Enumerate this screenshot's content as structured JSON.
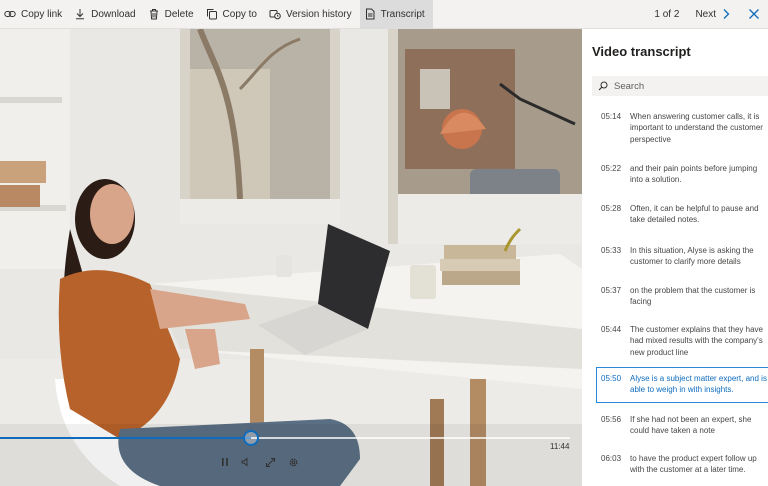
{
  "toolbar": {
    "buttons": [
      {
        "label": "Copy link",
        "icon": "link-icon"
      },
      {
        "label": "Download",
        "icon": "download-icon"
      },
      {
        "label": "Delete",
        "icon": "trash-icon"
      },
      {
        "label": "Copy to",
        "icon": "copy-icon"
      },
      {
        "label": "Version history",
        "icon": "history-icon"
      },
      {
        "label": "Transcript",
        "icon": "transcript-icon",
        "active": true
      }
    ],
    "pager": "1 of 2",
    "next_label": "Next"
  },
  "player": {
    "progress_fraction": 0.44,
    "duration": "11:44"
  },
  "transcript": {
    "title": "Video transcript",
    "search_placeholder": "Search",
    "entries": [
      {
        "time": "05:14",
        "text": "When answering customer calls, it is important to understand the customer perspective"
      },
      {
        "time": "05:22",
        "text": "and their pain points before jumping into a solution."
      },
      {
        "time": "05:28",
        "text": "Often, it can be helpful to pause and take detailed notes."
      },
      {
        "time": "05:33",
        "text": "In this situation, Alyse is asking the customer to clarify more details"
      },
      {
        "time": "05:37",
        "text": "on the problem that the customer is facing"
      },
      {
        "time": "05:44",
        "text": "The customer explains that they have had mixed results with the company's new product line"
      },
      {
        "time": "05:50",
        "text": "Alyse is a subject matter expert, and is able to weigh in with insights.",
        "active": true
      },
      {
        "time": "05:56",
        "text": "If she had not been an expert, she could have taken a note"
      },
      {
        "time": "06:03",
        "text": "to have the product expert follow up with the customer at a later time."
      }
    ]
  },
  "colors": {
    "accent": "#0f6cbd",
    "toolbar_bg": "#f3f2f1",
    "active_tab_bg": "#dcdcdc"
  }
}
